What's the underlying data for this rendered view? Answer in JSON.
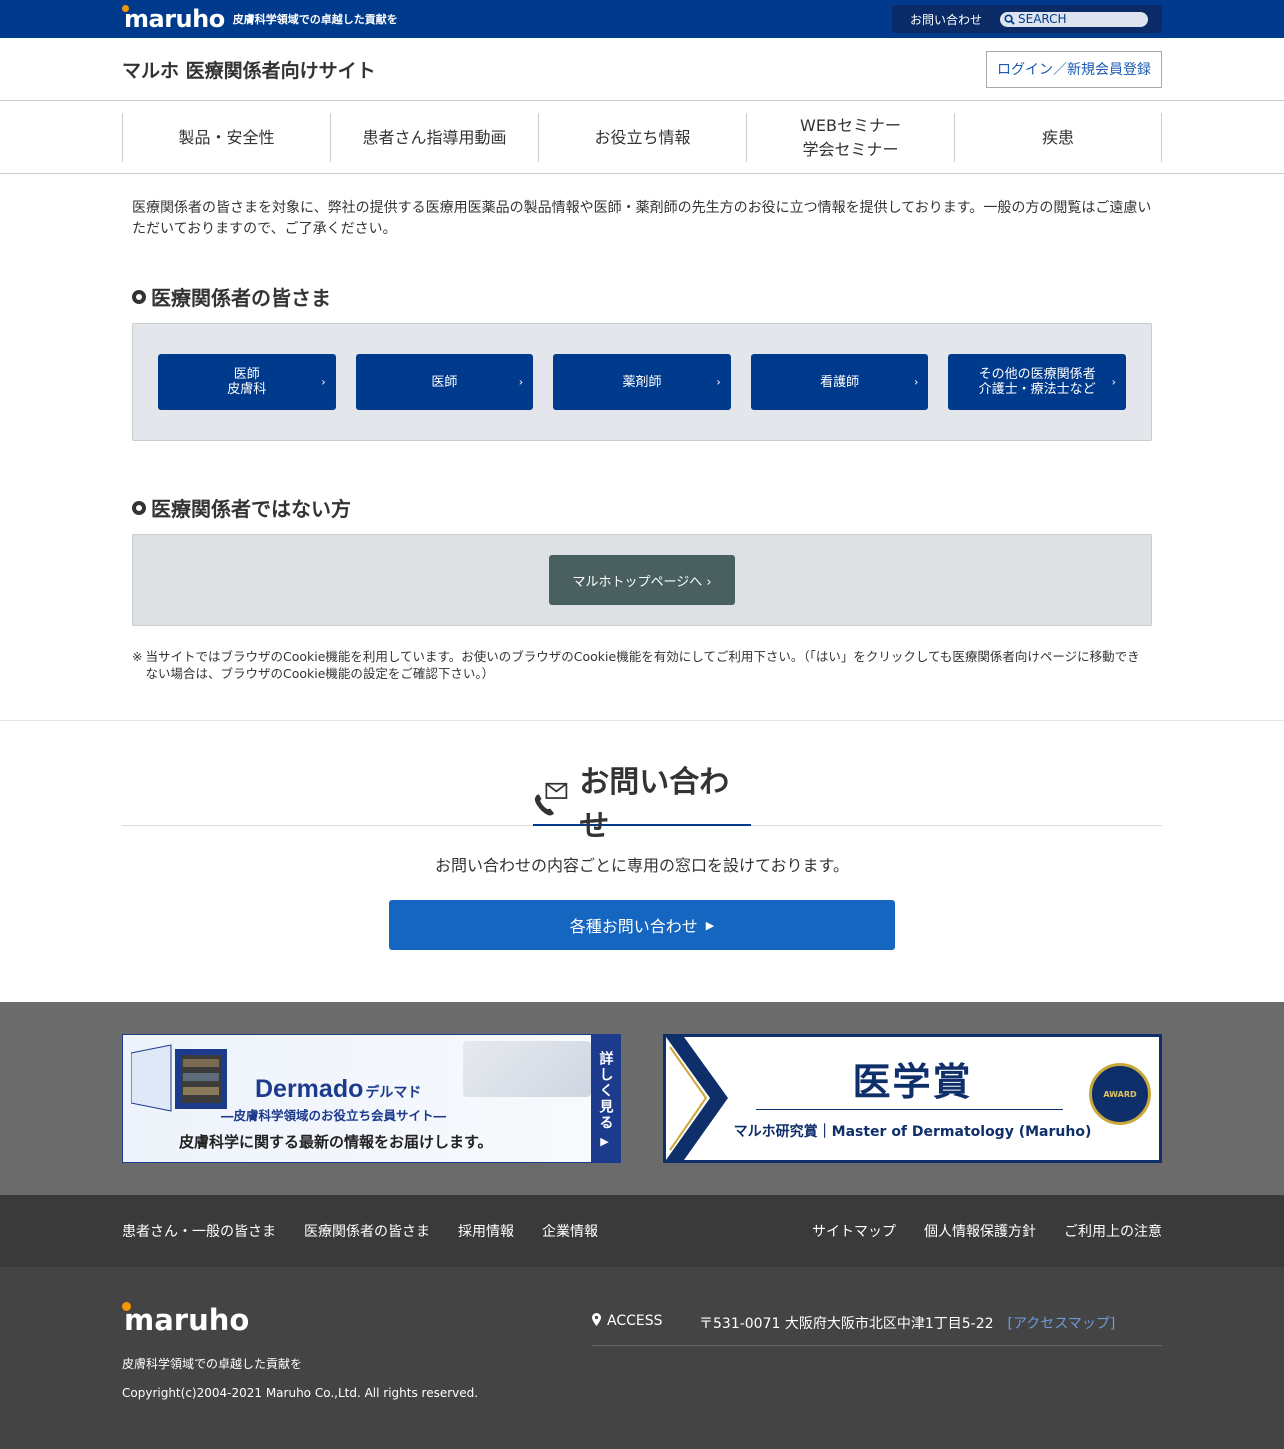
{
  "topbar": {
    "logo": "maruho",
    "tagline": "皮膚科学領域での卓越した貢献を",
    "contact_label": "お問い合わせ",
    "search_placeholder": "SEARCH"
  },
  "header": {
    "site_title": "マルホ 医療関係者向けサイト",
    "login_label": "ログイン／新規会員登録"
  },
  "nav": {
    "items": [
      {
        "label": "製品・安全性"
      },
      {
        "label": "患者さん指導用動画"
      },
      {
        "label": "お役立ち情報"
      },
      {
        "label": "WEBセミナー",
        "label2": "学会セミナー"
      },
      {
        "label": "疾患"
      }
    ]
  },
  "main": {
    "intro": "医療関係者の皆さまを対象に、弊社の提供する医療用医薬品の製品情報や医師・薬剤師の先生方のお役に立つ情報を提供しております。一般の方の閲覧はご遠慮いただいておりますので、ご了承ください。",
    "section1_title": "医療関係者の皆さま",
    "professions": [
      {
        "line1": "医師",
        "line2": "皮膚科"
      },
      {
        "line1": "医師",
        "line2": ""
      },
      {
        "line1": "薬剤師",
        "line2": ""
      },
      {
        "line1": "看護師",
        "line2": ""
      },
      {
        "line1": "その他の医療関係者",
        "line2": "介護士・療法士など"
      }
    ],
    "chevron": "›",
    "section2_title": "医療関係者ではない方",
    "top_page_label": "マルホトップページへ ›",
    "note_mark": "※",
    "note": "当サイトではブラウザのCookie機能を利用しています。お使いのブラウザのCookie機能を有効にしてご利用下さい。（「はい」をクリックしても医療関係者向けページに移動できない場合は、ブラウザのCookie機能の設定をご確認下さい。）"
  },
  "contact": {
    "title": "お問い合わせ",
    "text": "お問い合わせの内容ごとに専用の窓口を設けております。",
    "button_label": "各種お問い合わせ"
  },
  "banners": {
    "dermado_title": "Dermado",
    "dermado_title_kana": "デルマド",
    "dermado_sub": "―皮膚科学領域のお役立ち会員サイト―",
    "dermado_msg": "皮膚科学に関する最新の情報をお届けします。",
    "dermado_side": "詳しく見る",
    "award_title": "医学賞",
    "award_sub": "マルホ研究賞｜Master of Dermatology (Maruho)",
    "award_badge": "AWARD"
  },
  "footer_links": {
    "left": [
      "患者さん・一般の皆さま",
      "医療関係者の皆さま",
      "採用情報",
      "企業情報"
    ],
    "right": [
      "サイトマップ",
      "個人情報保護方針",
      "ご利用上の注意"
    ]
  },
  "footer": {
    "logo": "maruho",
    "tagline": "皮膚科学領域での卓越した貢献を",
    "copyright": "Copyright(c)2004-2021 Maruho Co.,Ltd. All rights reserved.",
    "access_label": "ACCESS",
    "address": "〒531-0071 大阪府大阪市北区中津1丁目5-22",
    "map_link": "[アクセスマップ]"
  },
  "colors": {
    "brand_blue": "#003a8c",
    "contact_blue": "#1566c0",
    "logo_orange": "#f39800"
  }
}
